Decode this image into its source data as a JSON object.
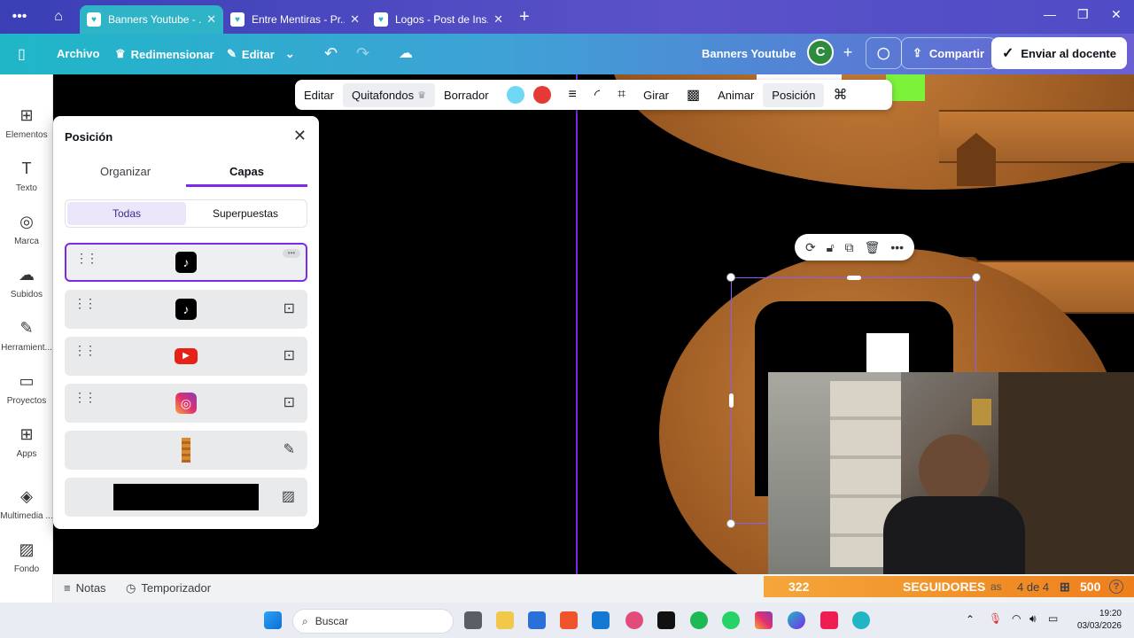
{
  "browser": {
    "tabs": [
      {
        "title": "Banners Youtube - ...",
        "active": true
      },
      {
        "title": "Entre Mentiras - Pr...",
        "active": false
      },
      {
        "title": "Logos - Post de Ins...",
        "active": false
      }
    ],
    "new_tab": "+",
    "window_controls": [
      "—",
      "❐",
      "✕"
    ]
  },
  "topbar": {
    "archivo": "Archivo",
    "redimensionar": "Redimensionar",
    "editar": "Editar",
    "design_title": "Banners Youtube",
    "avatar_letter": "C",
    "compartir": "Compartir",
    "enviar": "Enviar al docente"
  },
  "rail": [
    {
      "label": "Elementos",
      "icon": "elements-icon",
      "glyph": "⊞"
    },
    {
      "label": "Texto",
      "icon": "text-icon",
      "glyph": "T"
    },
    {
      "label": "Marca",
      "icon": "brand-icon",
      "glyph": "◎"
    },
    {
      "label": "Subidos",
      "icon": "cloud-upload-icon",
      "glyph": "☁"
    },
    {
      "label": "Herramient...",
      "icon": "pen-icon",
      "glyph": "✎"
    },
    {
      "label": "Proyectos",
      "icon": "folder-icon",
      "glyph": "▭"
    },
    {
      "label": "Apps",
      "icon": "apps-icon",
      "glyph": "⊞"
    },
    {
      "label": "Multimedia ...",
      "icon": "media-icon",
      "glyph": "◈"
    },
    {
      "label": "Fondo",
      "icon": "background-icon",
      "glyph": "▨"
    }
  ],
  "context_toolbar": {
    "editar": "Editar",
    "quitafondos": "Quitafondos",
    "borrador": "Borrador",
    "color1": "#6fd9f5",
    "color2": "#e53935",
    "girar": "Girar",
    "animar": "Animar",
    "posicion": "Posición"
  },
  "panel": {
    "title": "Posición",
    "tab_organizar": "Organizar",
    "tab_capas": "Capas",
    "seg_todas": "Todas",
    "seg_superpuestas": "Superpuestas"
  },
  "bottombar": {
    "notas": "Notas",
    "temporizador": "Temporizador",
    "page": "4 de 4",
    "zoom": "500",
    "help": "?"
  },
  "followers": {
    "count": "322",
    "label": "SEGUIDORES",
    "trailing": "as"
  },
  "taskbar": {
    "search": "Buscar",
    "time": "19:20",
    "date": "03/03/2026"
  }
}
